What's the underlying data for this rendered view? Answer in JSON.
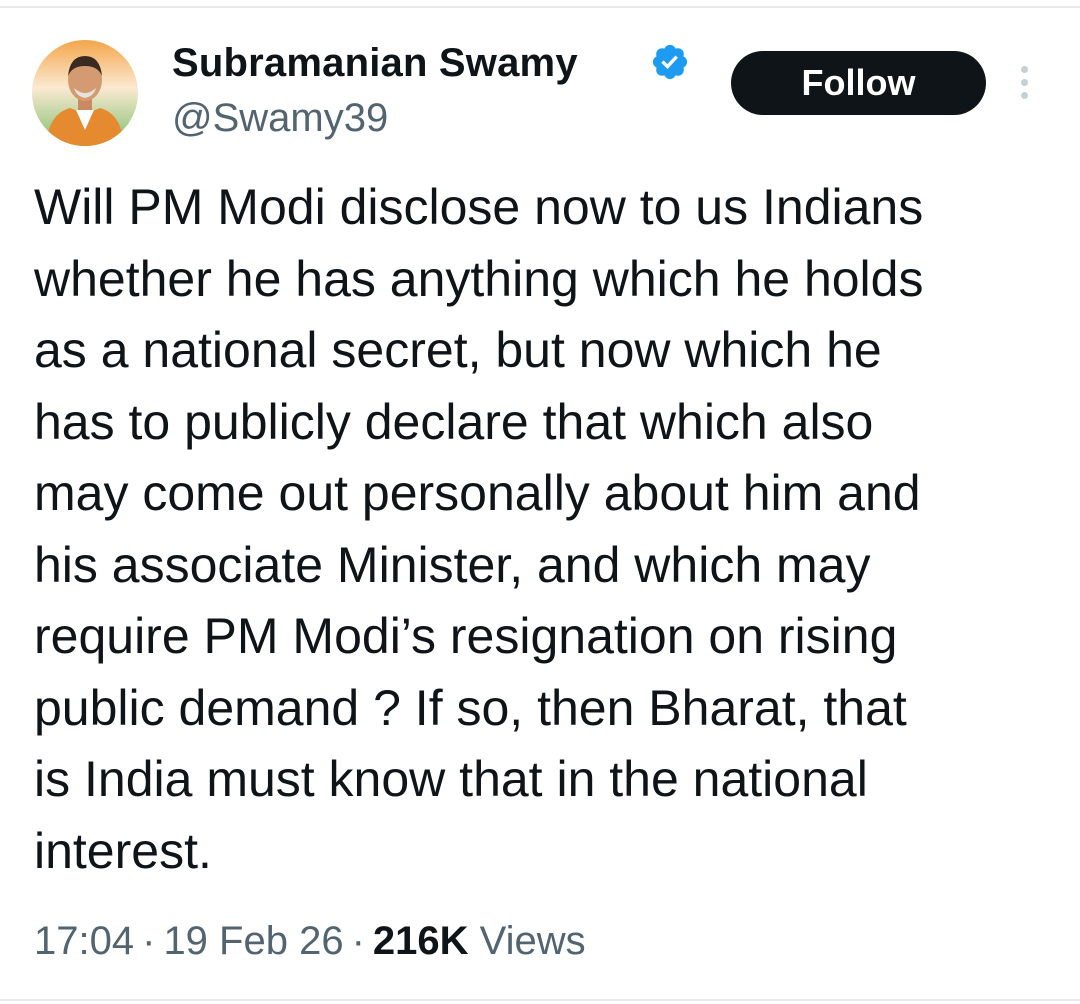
{
  "author": {
    "display_name": "Subramanian Swamy",
    "handle": "@Swamy39",
    "verified_color": "#1d9bf0",
    "avatar_icon": "profile-photo"
  },
  "actions": {
    "follow_label": "Follow",
    "more_icon": "more-vertical-icon"
  },
  "tweet": {
    "lines": [
      "Will PM Modi disclose now to us Indians",
      "whether he has anything which he holds",
      "as a national secret, but now which he",
      "has to publicly declare that which also",
      "may come out personally about him and",
      "his associate Minister, and which may",
      "require PM Modi’s resignation on rising",
      "public demand ? If so, then Bharat, that",
      "is India must know that in the national",
      "interest."
    ]
  },
  "meta": {
    "time": "17:04",
    "separator": "·",
    "date": "19 Feb 26",
    "views_count": "216K",
    "views_label": "Views"
  },
  "colors": {
    "text_primary": "#0f1419",
    "text_secondary": "#536471",
    "button_bg": "#0f1419",
    "button_text": "#ffffff"
  }
}
